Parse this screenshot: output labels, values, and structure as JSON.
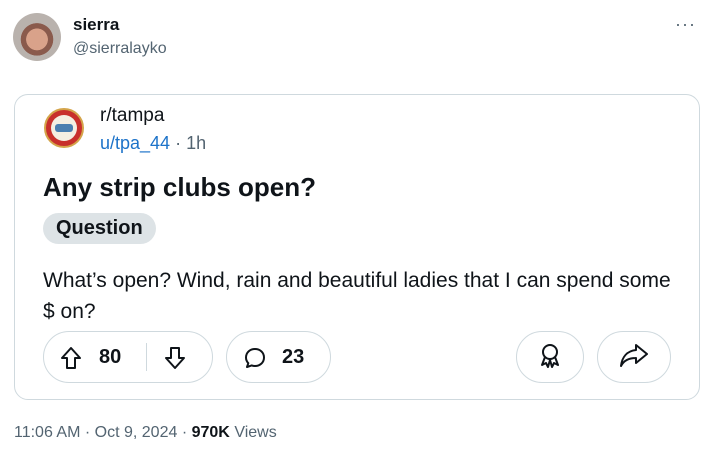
{
  "tweet": {
    "author_name": "sierra",
    "author_handle": "@sierralayko",
    "more": "···"
  },
  "post": {
    "subreddit": "r/tampa",
    "user": "u/tpa_44",
    "separator": "·",
    "age": "1h",
    "title": "Any strip clubs open?",
    "flair": "Question",
    "body": "What’s open? Wind, rain and beautiful ladies that I can spend some $ on?",
    "votes": "80",
    "comments": "23"
  },
  "footer": {
    "time": "11:06 AM",
    "dot1": "·",
    "date": "Oct 9, 2024",
    "dot2": "·",
    "views_count": "970K",
    "views_label": "Views"
  }
}
